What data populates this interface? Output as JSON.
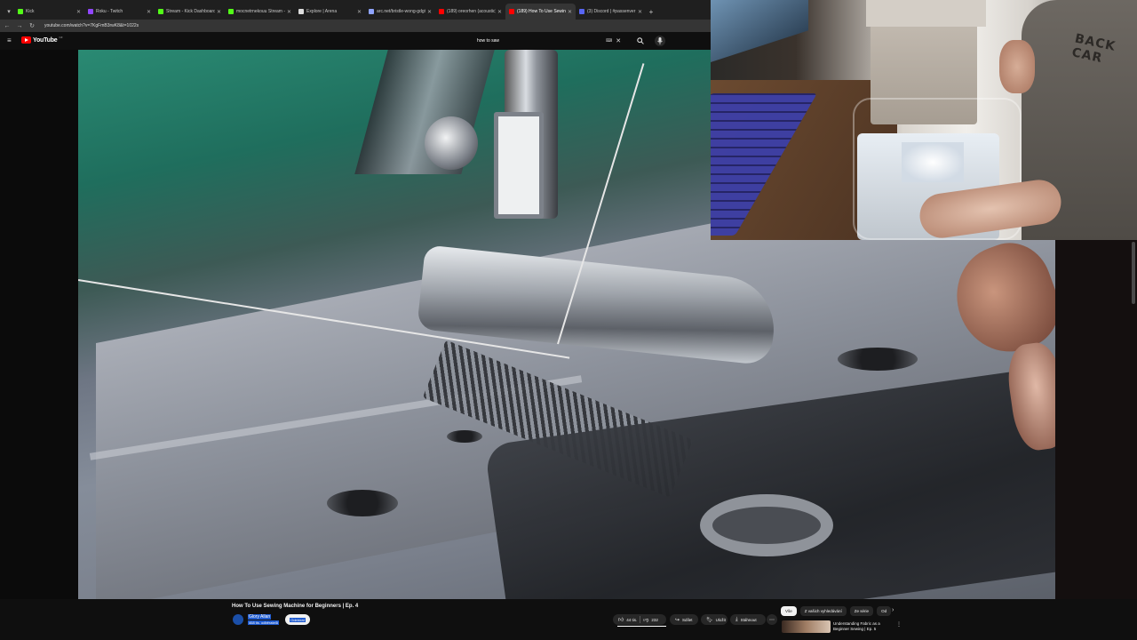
{
  "browser": {
    "tabs": [
      {
        "title": "Kick",
        "color": "#53fc18",
        "active": false
      },
      {
        "title": "Roku - Twitch",
        "color": "#9146ff",
        "active": false
      },
      {
        "title": "Stream - Kick Dashboard",
        "color": "#53fc18",
        "active": false
      },
      {
        "title": "mocnetrnekouu Stream - Ki",
        "color": "#53fc18",
        "active": false
      },
      {
        "title": "Explore | Arena",
        "color": "#dddddd",
        "active": false
      },
      {
        "title": "arc.net/bristle-wong-gdgiwoj",
        "color": "#8fa4ff",
        "active": false
      },
      {
        "title": "(189) oreorhen (acoustic) - Yo",
        "color": "#ff0000",
        "active": false
      },
      {
        "title": "(189) How To Use Sewing M",
        "color": "#ff0000",
        "active": true
      },
      {
        "title": "(3) Discord | #passenver | 555",
        "color": "#5865f2",
        "active": false
      }
    ],
    "new_tab": "+",
    "url": "youtube.com/watch?v=7KgFmB3rwK8&t=1022s"
  },
  "youtube": {
    "logo_text": "YouTube",
    "region": "CZ",
    "search_value": "how to saw",
    "video_title": "How To Use Sewing Machine for Beginners | Ep. 4",
    "channel_name": "Glory Allan",
    "channel_subs": "468 tis. odběratelů",
    "subscribe_label": "Odebírat",
    "actions": {
      "likes": "44 tis.",
      "dislike_count": "232",
      "share": "Sdílet",
      "save": "Uložit",
      "download": "Stáhnout"
    },
    "chips": [
      "Vše",
      "Z vašich vyhledávání",
      "Ze série",
      "Od"
    ],
    "recommended": {
      "title": "Understanding Fabric as a Beginner Sewing | Ep. 5"
    }
  },
  "webcam": {
    "shirt_text": "BACK\nCAR"
  },
  "colors": {
    "accent_red": "#ff0000",
    "background": "#0f0f0f",
    "pill": "#272727"
  }
}
